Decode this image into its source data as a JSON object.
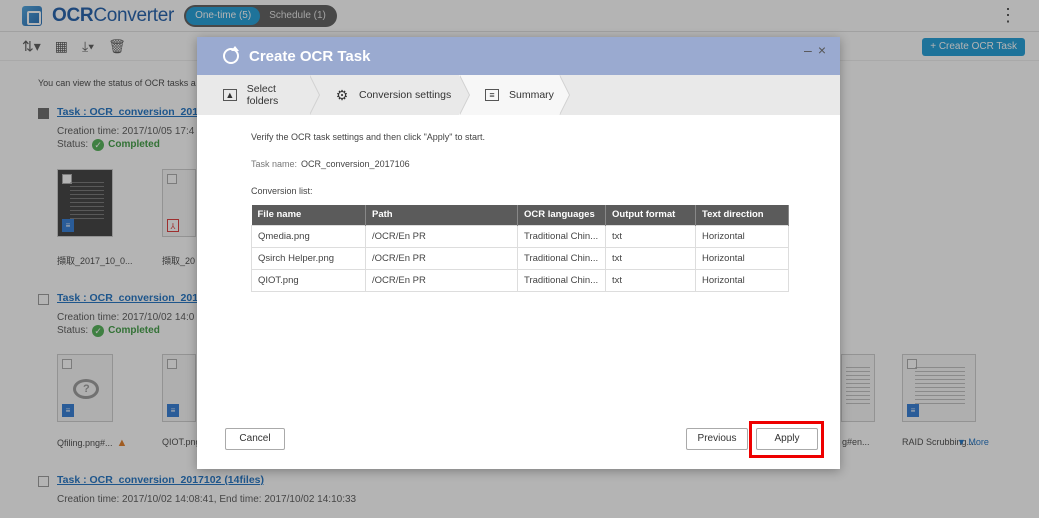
{
  "app": {
    "title_bold": "OCR",
    "title_light": "Converter",
    "tabs": [
      {
        "label": "One-time (5)",
        "active": true
      },
      {
        "label": "Schedule (1)",
        "active": false
      }
    ],
    "kebab_icon": "more-vertical-icon",
    "create_button": "+ Create OCR Task"
  },
  "toolbar": {
    "icons": [
      "sort-icon",
      "grid-view-icon",
      "download-icon",
      "delete-icon"
    ]
  },
  "background": {
    "info_text": "You can view the status of OCR tasks a",
    "tasks": [
      {
        "title": "Task : OCR_conversion_20171",
        "files": "",
        "creation": "Creation time: 2017/10/05 17:4",
        "status_label": "Status:",
        "status": "Completed",
        "thumbs": [
          "擷取_2017_10_0...",
          "擷取_20"
        ]
      },
      {
        "title": "Task : OCR_conversion_20171",
        "files": "",
        "creation": "Creation time: 2017/10/02 14:0",
        "status_label": "Status:",
        "status": "Completed",
        "thumbs": [
          "Qfiling.png#...",
          "QIOT.png",
          "g#en...",
          "RAID Scrubbing...."
        ]
      },
      {
        "title": "Task : OCR_conversion_2017102 ",
        "files": "(14files)",
        "creation": "Creation time: 2017/10/02 14:08:41, End time: 2017/10/02 14:10:33",
        "status_label": "",
        "status": ""
      }
    ],
    "more_link": "▼ More"
  },
  "dialog": {
    "title": "Create OCR Task",
    "controls": "– ×",
    "steps": [
      {
        "label": "Select folders",
        "icon": "folder-image-icon"
      },
      {
        "label": "Conversion settings",
        "icon": "gear-icon"
      },
      {
        "label": "Summary",
        "icon": "clipboard-icon"
      }
    ],
    "verify_text": "Verify the OCR task settings and then click \"Apply\" to start.",
    "task_name_label": "Task name:",
    "task_name_value": "OCR_conversion_2017106",
    "conversion_list_label": "Conversion list:",
    "table": {
      "headers": [
        "File name",
        "Path",
        "OCR languages",
        "Output format",
        "Text direction"
      ],
      "rows": [
        [
          "Qmedia.png",
          "/OCR/En PR",
          "Traditional Chin...",
          "txt",
          "Horizontal"
        ],
        [
          "Qsirch Helper.png",
          "/OCR/En PR",
          "Traditional Chin...",
          "txt",
          "Horizontal"
        ],
        [
          "QIOT.png",
          "/OCR/En PR",
          "Traditional Chin...",
          "txt",
          "Horizontal"
        ]
      ]
    },
    "buttons": {
      "cancel": "Cancel",
      "previous": "Previous",
      "apply": "Apply"
    },
    "highlight_color": "#ee0000"
  }
}
